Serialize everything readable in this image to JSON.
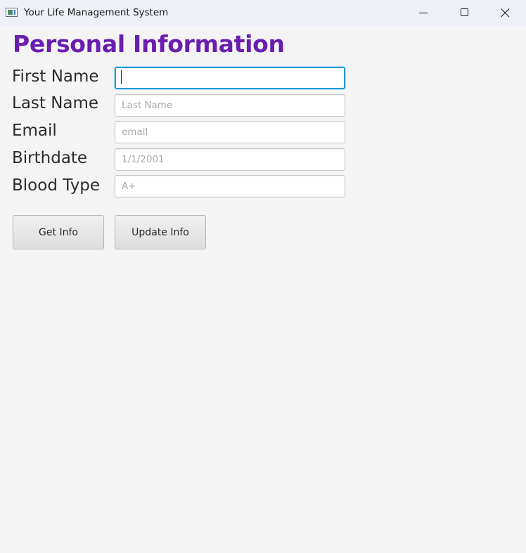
{
  "window": {
    "title": "Your Life Management System",
    "icon": "app-window-icon",
    "controls": {
      "minimize_icon": "minimize-icon",
      "maximize_icon": "maximize-icon",
      "close_icon": "close-icon"
    }
  },
  "form": {
    "heading": "Personal Information",
    "heading_color": "#6a1db0",
    "fields": [
      {
        "label": "First Name",
        "value": "",
        "placeholder": "",
        "focused": true
      },
      {
        "label": "Last Name",
        "value": "",
        "placeholder": "Last Name"
      },
      {
        "label": "Email",
        "value": "",
        "placeholder": "email"
      },
      {
        "label": "Birthdate",
        "value": "",
        "placeholder": "1/1/2001"
      },
      {
        "label": "Blood Type",
        "value": "",
        "placeholder": "A+"
      }
    ],
    "focus_color": "#1f9ad6"
  },
  "buttons": {
    "get_info": "Get Info",
    "update_info": "Update Info"
  }
}
